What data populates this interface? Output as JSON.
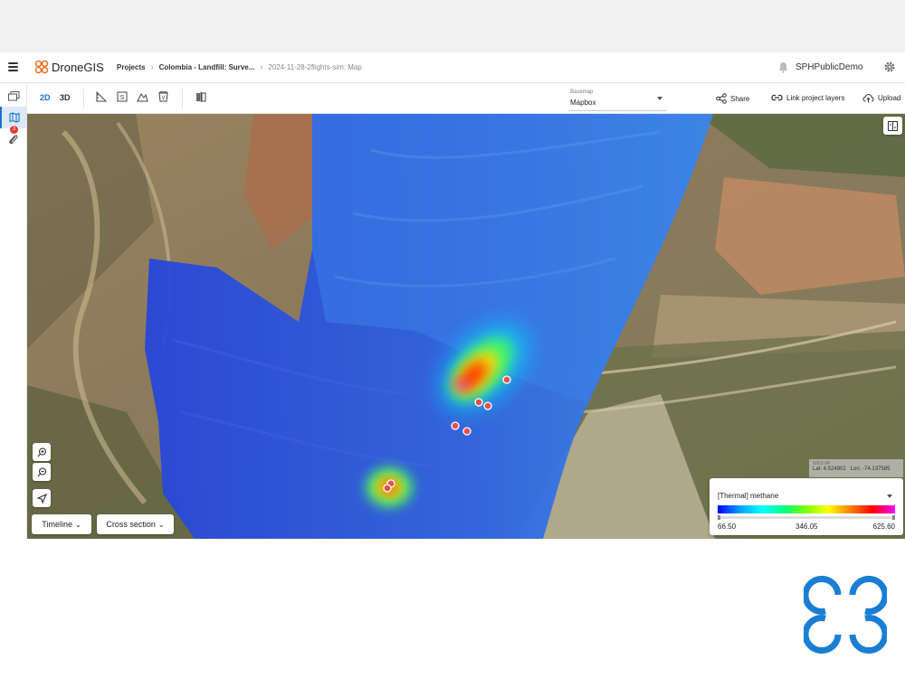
{
  "header": {
    "app_name": "DroneGIS",
    "breadcrumbs": [
      "Projects",
      "Colombia - Landfill: Surve...",
      "2024-11-28-2flights-sim: Map"
    ],
    "user_name": "SPHPublicDemo"
  },
  "rail": {
    "layers_badge": "3"
  },
  "toolbar": {
    "mode_2d": "2D",
    "mode_3d": "3D",
    "basemap_label": "Basemap",
    "basemap_value": "Mapbox",
    "share_label": "Share",
    "link_label": "Link project layers",
    "upload_label": "Upload"
  },
  "map": {
    "coords_crs": "WGS 84",
    "lat": "Lat: 4.524802",
    "lon": "Lon: -74.137585",
    "timeline_label": "Timeline",
    "cross_section_label": "Cross section"
  },
  "legend": {
    "title": "[Thermal] methane",
    "min": "66.50",
    "mid": "346.05",
    "max": "625.60"
  },
  "colors": {
    "accent": "#1e6fd0",
    "brand_orange": "#e8742a",
    "watermark_blue": "#1a7fd4"
  }
}
